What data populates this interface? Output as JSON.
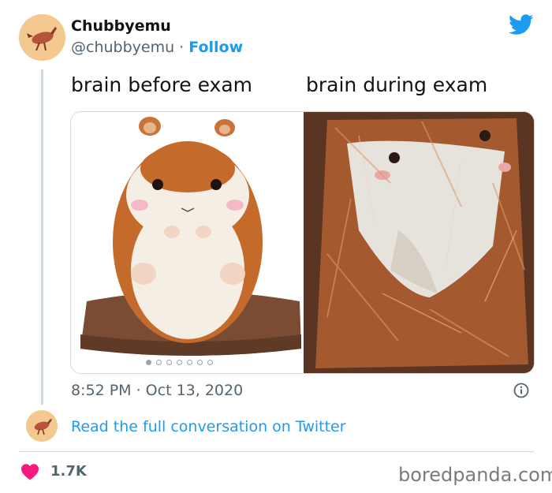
{
  "tweet": {
    "display_name": "Chubbyemu",
    "handle": "@chubbyemu",
    "separator": " · ",
    "follow_label": "Follow",
    "captions": [
      "brain before exam",
      "brain during exam"
    ],
    "timestamp": "8:52 PM · Oct 13, 2020",
    "carousel": {
      "dot_count": 7,
      "active_index": 0
    },
    "colors": {
      "accent": "#1d9bf0",
      "heart": "#f91880"
    }
  },
  "conversation": {
    "link_label": "Read the full conversation on Twitter"
  },
  "footer": {
    "likes": "1.7K",
    "brand": "boredpanda.com"
  },
  "icons": [
    "twitter-bird-icon",
    "info-icon",
    "heart-icon"
  ]
}
